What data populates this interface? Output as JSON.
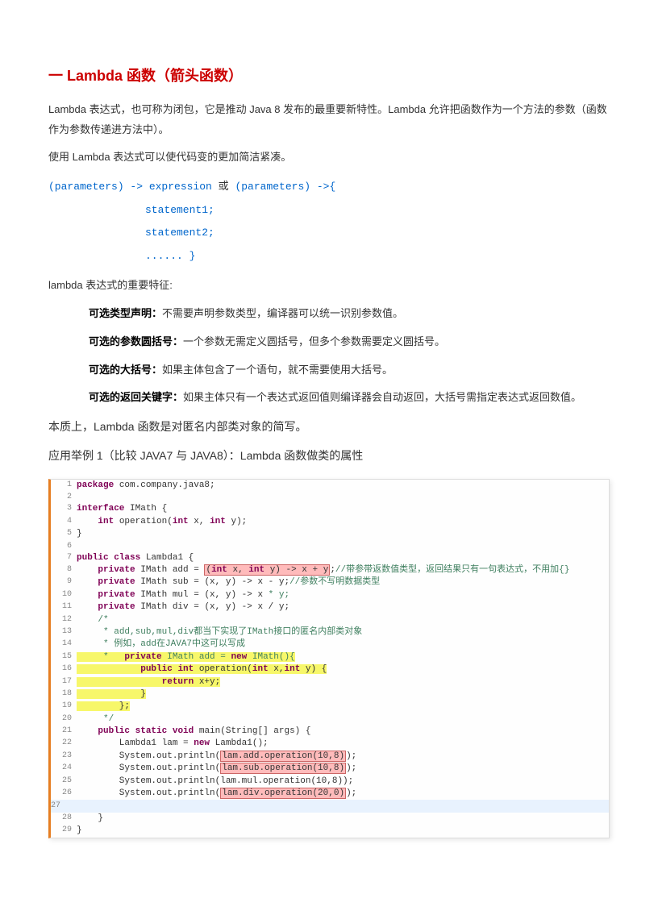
{
  "heading": "一 Lambda 函数（箭头函数）",
  "p1": "Lambda 表达式，也可称为闭包，它是推动 Java 8 发布的最重要新特性。Lambda 允许把函数作为一个方法的参数（函数作为参数传递进方法中）。",
  "p2": "使用 Lambda 表达式可以使代码变的更加简洁紧凑。",
  "code": {
    "l1a": "(parameters) -> expression",
    "l1m": " 或 ",
    "l1b": "(parameters) ->{",
    "l2": "statement1;",
    "l3": "statement2;",
    "l4": "...... }"
  },
  "p3": "lambda 表达式的重要特征:",
  "f1b": "可选类型声明：",
  "f1": "不需要声明参数类型，编译器可以统一识别参数值。",
  "f2b": "可选的参数圆括号：",
  "f2": "一个参数无需定义圆括号，但多个参数需要定义圆括号。",
  "f3b": "可选的大括号：",
  "f3": "如果主体包含了一个语句，就不需要使用大括号。",
  "f4b": "可选的返回关键字：",
  "f4": "如果主体只有一个表达式返回值则编译器会自动返回，大括号需指定表达式返回数值。",
  "p4": "本质上，Lambda 函数是对匿名内部类对象的简写。",
  "p5": "应用举例 1（比较 JAVA7 与 JAVA8）：Lambda 函数做类的属性",
  "snippet": {
    "lines": [
      {
        "n": "1",
        "c": "package com.company.java8;",
        "kw": "package"
      },
      {
        "n": "2",
        "c": ""
      },
      {
        "n": "3",
        "c": "interface IMath {",
        "kw": "interface"
      },
      {
        "n": "4",
        "c": "    int operation(int x, int y);",
        "kw": "int"
      },
      {
        "n": "5",
        "c": "}"
      },
      {
        "n": "6",
        "c": ""
      },
      {
        "n": "7",
        "c": "public class Lambda1 {",
        "kw": "public class"
      },
      {
        "n": "8",
        "c": "    private IMath add = (int x, int y) -> x + y;//带参带返数值类型，返回结果只有一句表达式，不用加{}",
        "kw": "private",
        "hl": "orange"
      },
      {
        "n": "9",
        "c": "    private IMath sub = (x, y) -> x - y;//参数不写明数据类型",
        "kw": "private"
      },
      {
        "n": "10",
        "c": "    private IMath mul = (x, y) -> x * y;",
        "kw": "private"
      },
      {
        "n": "11",
        "c": "    private IMath div = (x, y) -> x / y;",
        "kw": "private"
      },
      {
        "n": "12",
        "c": "    /*"
      },
      {
        "n": "13",
        "c": "     * add,sub,mul,div都当下实现了IMath接口的匿名内部类对象"
      },
      {
        "n": "14",
        "c": "     * 例如，add在JAVA7中这可以写成"
      },
      {
        "n": "15",
        "c": "     *   private IMath add = new IMath(){",
        "hl": "yellow"
      },
      {
        "n": "16",
        "c": "            public int operation(int x,int y) {",
        "hl": "yellow"
      },
      {
        "n": "17",
        "c": "                return x+y;",
        "hl": "yellow"
      },
      {
        "n": "18",
        "c": "            }",
        "hl": "yellow"
      },
      {
        "n": "19",
        "c": "        };",
        "hl": "yellow"
      },
      {
        "n": "20",
        "c": "     */"
      },
      {
        "n": "21",
        "c": "    public static void main(String[] args) {",
        "kw": "public static void"
      },
      {
        "n": "22",
        "c": "        Lambda1 lam = new Lambda1();",
        "kw": "new"
      },
      {
        "n": "23",
        "c": "        System.out.println(lam.add.operation(10,8));",
        "hl": "orange2"
      },
      {
        "n": "24",
        "c": "        System.out.println(lam.sub.operation(10,8));",
        "hl": "orange2"
      },
      {
        "n": "25",
        "c": "        System.out.println(lam.mul.operation(10,8));"
      },
      {
        "n": "26",
        "c": "        System.out.println(lam.div.operation(20,0));",
        "hl": "orange2"
      },
      {
        "n": "27",
        "c": "",
        "hlline": true
      },
      {
        "n": "28",
        "c": "    }"
      },
      {
        "n": "29",
        "c": "}"
      }
    ]
  }
}
